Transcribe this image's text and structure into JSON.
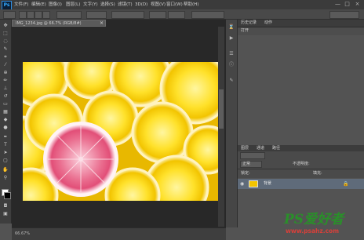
{
  "app": {
    "logo": "Ps"
  },
  "menu": [
    "文件(F)",
    "编辑(E)",
    "图像(I)",
    "图层(L)",
    "文字(Y)",
    "选择(S)",
    "滤镜(T)",
    "3D(D)",
    "视图(V)",
    "窗口(W)",
    "帮助(H)"
  ],
  "window_controls": [
    "—",
    "□",
    "×"
  ],
  "document": {
    "tab_label": "IMG_1234.jpg @ 66.7% (RGB/8#)",
    "close_glyph": "×"
  },
  "status": {
    "zoom": "66.67%"
  },
  "panels": {
    "top_tabs": [
      "历史记录",
      "动作"
    ],
    "history_doc": "打开",
    "layers_tabs": [
      "图层",
      "通道",
      "路径"
    ],
    "layers_opts": [
      "正常",
      "不透明度:",
      "锁定:",
      "填充:"
    ]
  },
  "layer": {
    "name": "背景",
    "eye_icon": "visible-eye",
    "lock_icon": "lock"
  },
  "watermark": {
    "main": "PS爱好者",
    "url": "www.psahz.com"
  },
  "colors": {
    "lemon": "#f2c400",
    "grapefruit": "#e85a7d",
    "panel_bg": "#535353",
    "canvas_bg": "#282828"
  }
}
